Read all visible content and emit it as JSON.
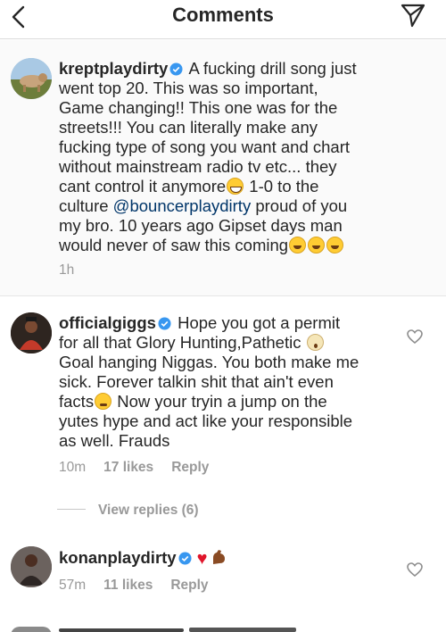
{
  "header": {
    "title": "Comments",
    "back_icon": "chevron-left-icon",
    "send_icon": "paper-plane-icon"
  },
  "caption": {
    "username": "kreptplaydirty",
    "text_1": "A fucking drill song just",
    "text_2": "went top 20. This was so important,",
    "text_3": "Game changing!! This one was for the",
    "text_4": "streets!!! You can literally make any",
    "text_5": "fucking type of song you want and chart",
    "text_6": "without mainstream radio tv etc... they",
    "text_7a": "cant control it anymore",
    "text_7b": "1-0 to the",
    "text_8a": "culture ",
    "mention": "@bouncerplaydirty",
    "text_8b": " proud of you",
    "text_9": "my bro. 10 years ago Gipset days man",
    "text_10": "would never of saw this coming",
    "time": "1h"
  },
  "comments": [
    {
      "username": "officialgiggs",
      "line_1": "Hope you got a permit",
      "line_2": "for all that Glory Hunting,Pathetic",
      "line_3": "Goal hanging Niggas.  You both make me",
      "line_4": "sick. Forever talkin shit that ain't even",
      "line_5a": "facts",
      "line_5b": " Now your tryin a jump on the",
      "line_6": "yutes hype and act like your responsible",
      "line_7": "as well. Frauds",
      "time": "10m",
      "likes": "17 likes",
      "reply": "Reply"
    },
    {
      "username": "konanplaydirty",
      "time": "57m",
      "likes": "11 likes",
      "reply": "Reply"
    }
  ],
  "view_replies": "View replies (6)",
  "colors": {
    "verified": "#3897f0",
    "mention": "#003569",
    "meta": "#999999",
    "heart": "#e0162b"
  }
}
